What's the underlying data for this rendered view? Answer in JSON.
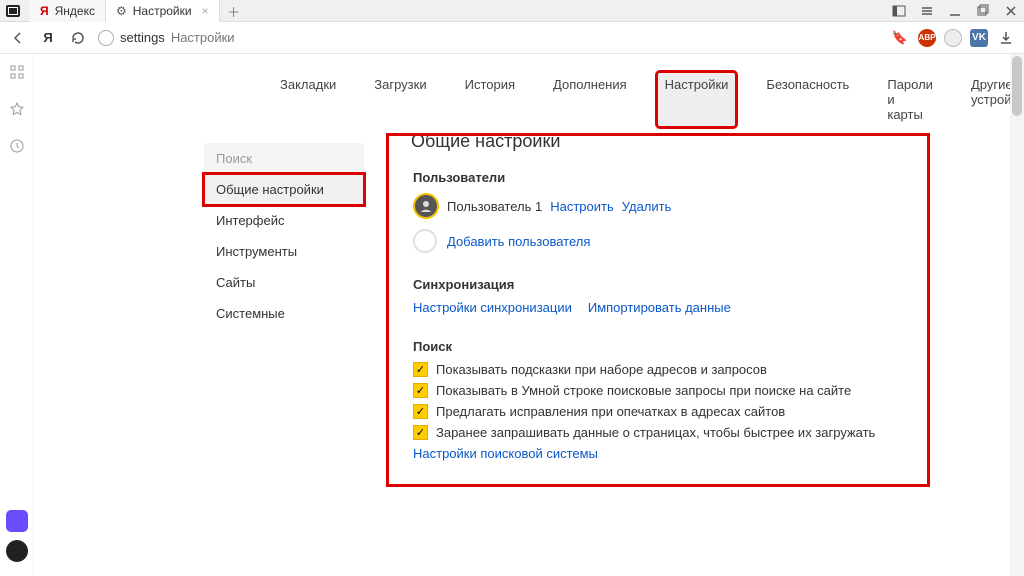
{
  "tabs": [
    {
      "title": "Яндекс"
    },
    {
      "title": "Настройки"
    }
  ],
  "address": {
    "host": "settings",
    "path": "Настройки"
  },
  "page_nav": {
    "items": [
      "Закладки",
      "Загрузки",
      "История",
      "Дополнения",
      "Настройки",
      "Безопасность",
      "Пароли и карты",
      "Другие устройства"
    ]
  },
  "side_nav": {
    "items": [
      "Поиск",
      "Общие настройки",
      "Интерфейс",
      "Инструменты",
      "Сайты",
      "Системные"
    ]
  },
  "main": {
    "title": "Общие настройки",
    "users": {
      "heading": "Пользователи",
      "user_name": "Пользователь 1",
      "configure": "Настроить",
      "delete": "Удалить",
      "add_user": "Добавить пользователя"
    },
    "sync": {
      "heading": "Синхронизация",
      "settings_link": "Настройки синхронизации",
      "import_link": "Импортировать данные"
    },
    "search": {
      "heading": "Поиск",
      "checks": [
        "Показывать подсказки при наборе адресов и запросов",
        "Показывать в Умной строке поисковые запросы при поиске на сайте",
        "Предлагать исправления при опечатках в адресах сайтов",
        "Заранее запрашивать данные о страницах, чтобы быстрее их загружать"
      ],
      "engine_link": "Настройки поисковой системы"
    }
  },
  "ext": {
    "abp": "ABP",
    "vk": "VK"
  }
}
